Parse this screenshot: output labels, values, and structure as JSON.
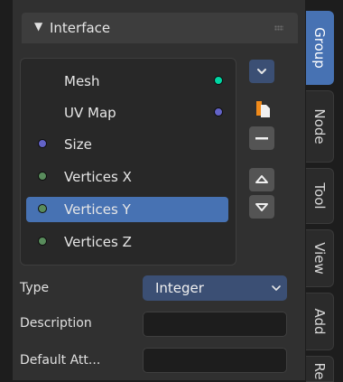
{
  "panel": {
    "title": "Interface",
    "expanded": true
  },
  "list": {
    "items": [
      {
        "label": "Mesh",
        "socket_side": "output",
        "socket_color": "#00d6a3"
      },
      {
        "label": "UV Map",
        "socket_side": "output",
        "socket_color": "#6363c7"
      },
      {
        "label": "Size",
        "socket_side": "input",
        "socket_color": "#6363c7"
      },
      {
        "label": "Vertices X",
        "socket_side": "input",
        "socket_color": "#598c5c"
      },
      {
        "label": "Vertices Y",
        "socket_side": "input",
        "socket_color": "#598c5c",
        "selected": true
      },
      {
        "label": "Vertices Z",
        "socket_side": "input",
        "socket_color": "#598c5c"
      }
    ]
  },
  "list_buttons": [
    {
      "name": "add-dropdown-button",
      "icon": "chevron-down-icon"
    },
    {
      "name": "duplicate-button",
      "icon": "duplicate-icon"
    },
    {
      "name": "remove-button",
      "icon": "minus-icon"
    },
    {
      "name": "move-up-button",
      "icon": "triangle-up-icon"
    },
    {
      "name": "move-down-button",
      "icon": "triangle-down-icon"
    }
  ],
  "properties": {
    "type_label": "Type",
    "type_value": "Integer",
    "description_label": "Description",
    "description_value": "",
    "default_label": "Default Att...",
    "default_value": ""
  },
  "tabs": [
    "Group",
    "Node",
    "Tool",
    "View",
    "Add",
    "Re"
  ],
  "active_tab": "Group",
  "colors": {
    "accent": "#4772b3",
    "select_field": "#3b4f74",
    "duplicate_icon_accent": "#f08a1a"
  }
}
